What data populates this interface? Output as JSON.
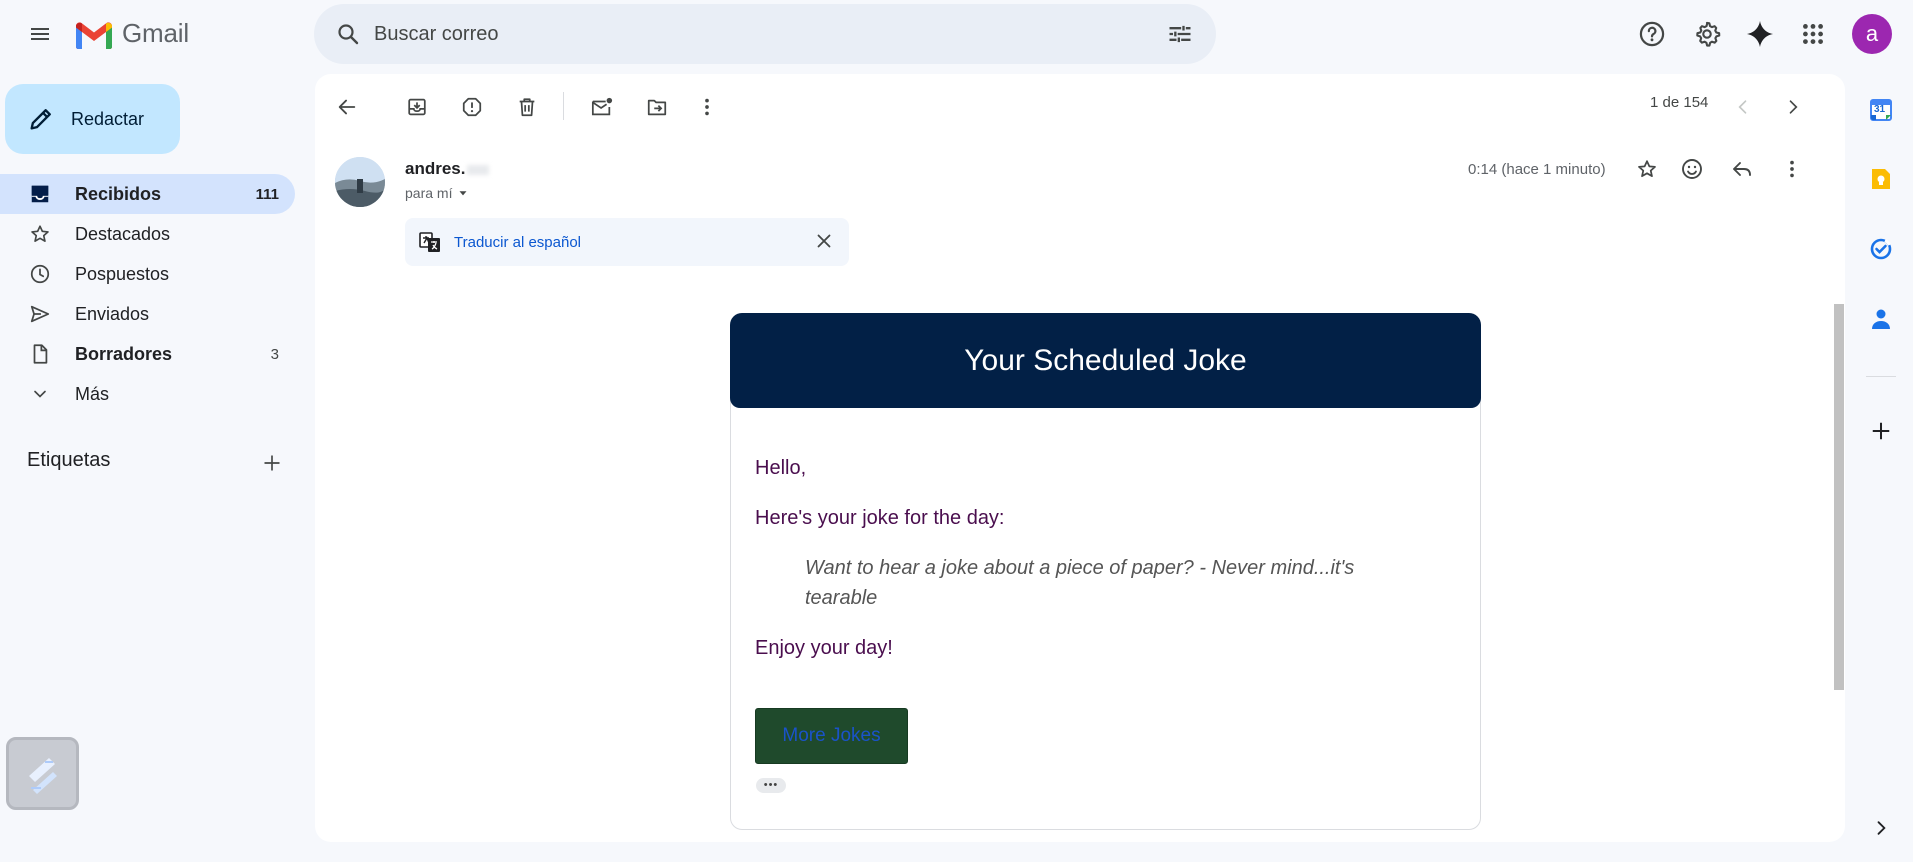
{
  "app": {
    "name": "Gmail"
  },
  "search": {
    "placeholder": "Buscar correo"
  },
  "user": {
    "avatar_letter": "a",
    "avatar_color": "#9c27b0"
  },
  "sidebar": {
    "compose_label": "Redactar",
    "items": [
      {
        "label": "Recibidos",
        "count": "111",
        "icon": "inbox-icon"
      },
      {
        "label": "Destacados",
        "count": "",
        "icon": "star-icon"
      },
      {
        "label": "Pospuestos",
        "count": "",
        "icon": "clock-icon"
      },
      {
        "label": "Enviados",
        "count": "",
        "icon": "send-icon"
      },
      {
        "label": "Borradores",
        "count": "3",
        "icon": "draft-icon"
      },
      {
        "label": "Más",
        "count": "",
        "icon": "chevron-down-icon"
      }
    ],
    "labels_title": "Etiquetas"
  },
  "toolbar": {
    "pager": "1 de 154"
  },
  "message": {
    "sender": "andres.",
    "to": "para mí",
    "time": "0:14 (hace 1 minuto)",
    "translate_label": "Traducir al español"
  },
  "email": {
    "header_title": "Your Scheduled Joke",
    "header_bg": "#022046",
    "greeting": "Hello,",
    "intro": "Here's your joke for the day:",
    "joke": "Want to hear a joke about a piece of paper? - Never mind...it's tearable",
    "closing": "Enjoy your day!",
    "button_label": "More Jokes",
    "text_color": "#4a0e4e",
    "button_bg": "#1f4a2c"
  },
  "side_apps": {
    "calendar_day": "31"
  },
  "colors": {
    "accent": "#0b57d0",
    "active_nav": "#d3e3fd",
    "compose_bg": "#c2e7ff"
  }
}
